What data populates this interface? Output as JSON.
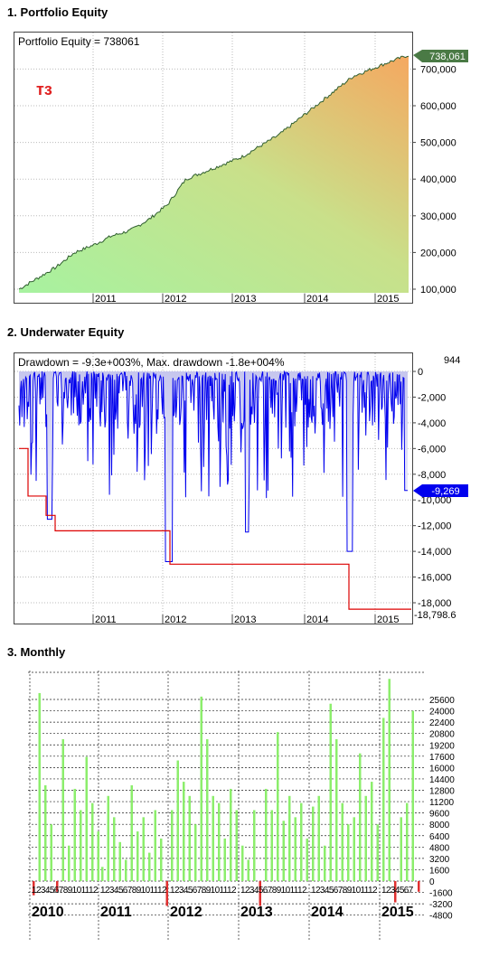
{
  "sections": {
    "s1": "1. Portfolio Equity",
    "s2": "2. Underwater Equity",
    "s3": "3. Monthly"
  },
  "equity": {
    "header": "Portfolio Equity = 738061",
    "badge": "тз",
    "last_value_label": "738,061",
    "y_ticks": [
      "100,000",
      "200,000",
      "300,000",
      "400,000",
      "500,000",
      "600,000",
      "700,000"
    ],
    "x_ticks": [
      "2011",
      "2012",
      "2013",
      "2014",
      "2015"
    ]
  },
  "underwater": {
    "header": "Drawdown = -9.3e+003%, Max. drawdown -1.8e+004%",
    "top_label": "944",
    "last_label": "-9,269",
    "bottom_label": "-18,798.6",
    "y_ticks": [
      "0",
      "-2,000",
      "-4,000",
      "-6,000",
      "-8,000",
      "-10,000",
      "-12,000",
      "-14,000",
      "-16,000",
      "-18,000"
    ],
    "x_ticks": [
      "2011",
      "2012",
      "2013",
      "2014",
      "2015"
    ]
  },
  "monthly": {
    "y_ticks": [
      "25600",
      "24000",
      "22400",
      "20800",
      "19200",
      "17600",
      "16000",
      "14400",
      "12800",
      "11200",
      "9600",
      "8000",
      "6400",
      "4800",
      "3200",
      "1600",
      "0",
      "-1600",
      "-3200",
      "-4800"
    ],
    "year_labels": [
      "2010",
      "2011",
      "2012",
      "2013",
      "2014",
      "2015"
    ],
    "month_strings": [
      "123456789101112",
      "123456789101112",
      "123456789101112",
      "123456789101112",
      "123456789101112",
      "1234567"
    ]
  },
  "chart_data": [
    {
      "type": "area",
      "title": "Portfolio Equity = 738061",
      "x": [
        "2010-04",
        "2010-07",
        "2010-10",
        "2011-01",
        "2011-04",
        "2011-07",
        "2011-10",
        "2012-01",
        "2012-04",
        "2012-07",
        "2012-10",
        "2013-01",
        "2013-04",
        "2013-07",
        "2013-10",
        "2014-01",
        "2014-04",
        "2014-07",
        "2014-10",
        "2015-01",
        "2015-04",
        "2015-07"
      ],
      "series": [
        {
          "values": [
            100000,
            130000,
            160000,
            200000,
            220000,
            245000,
            260000,
            290000,
            330000,
            400000,
            420000,
            440000,
            460000,
            490000,
            520000,
            560000,
            600000,
            640000,
            680000,
            700000,
            720000,
            738061
          ]
        }
      ],
      "ylim": [
        90000,
        760000
      ],
      "grid": true
    },
    {
      "type": "line",
      "title": "Drawdown = -9.3e+003%, Max. drawdown -1.8e+004%",
      "x": [
        "2010-04",
        "2010-09",
        "2011-01",
        "2011-06",
        "2011-12",
        "2012-06",
        "2012-12",
        "2013-06",
        "2013-12",
        "2014-06",
        "2014-09",
        "2015-01",
        "2015-07"
      ],
      "series": [
        {
          "name": "Max. drawdown",
          "values": [
            -6000,
            -11500,
            -12400,
            -12400,
            -15000,
            -15000,
            -15000,
            -15000,
            -15000,
            -15000,
            -18500,
            -18500,
            -18500
          ]
        }
      ],
      "ylim": [
        -18798.6,
        944
      ],
      "grid": true
    },
    {
      "type": "bar",
      "categories": [
        "2010-01",
        "2010-02",
        "2010-03",
        "2010-04",
        "2010-05",
        "2010-06",
        "2010-07",
        "2010-08",
        "2010-09",
        "2010-10",
        "2010-11",
        "2010-12",
        "2011-01",
        "2011-02",
        "2011-03",
        "2011-04",
        "2011-05",
        "2011-06",
        "2011-07",
        "2011-08",
        "2011-09",
        "2011-10",
        "2011-11",
        "2011-12",
        "2012-01",
        "2012-02",
        "2012-03",
        "2012-04",
        "2012-05",
        "2012-06",
        "2012-07",
        "2012-08",
        "2012-09",
        "2012-10",
        "2012-11",
        "2012-12",
        "2013-01",
        "2013-02",
        "2013-03",
        "2013-04",
        "2013-05",
        "2013-06",
        "2013-07",
        "2013-08",
        "2013-09",
        "2013-10",
        "2013-11",
        "2013-12",
        "2014-01",
        "2014-02",
        "2014-03",
        "2014-04",
        "2014-05",
        "2014-06",
        "2014-07",
        "2014-08",
        "2014-09",
        "2014-10",
        "2014-11",
        "2014-12",
        "2015-01",
        "2015-02",
        "2015-03",
        "2015-04",
        "2015-05",
        "2015-06",
        "2015-07"
      ],
      "values": [
        -2000,
        26500,
        13500,
        8000,
        -1500,
        20000,
        5000,
        13000,
        10000,
        17500,
        11000,
        7000,
        2000,
        12000,
        9000,
        5500,
        3000,
        13500,
        7000,
        9000,
        4000,
        10000,
        6000,
        -3500,
        10000,
        17000,
        14000,
        12000,
        8000,
        26000,
        20000,
        12000,
        11000,
        6000,
        13000,
        10000,
        5000,
        3000,
        10000,
        -3500,
        13000,
        10000,
        21000,
        8500,
        12000,
        9000,
        11000,
        6000,
        10500,
        12000,
        5000,
        25000,
        20000,
        11000,
        8000,
        9000,
        18000,
        12000,
        14000,
        8000,
        23000,
        28500,
        -3000,
        9000,
        11000,
        24000,
        -1500
      ],
      "ylim": [
        -4800,
        28000
      ],
      "grid": true
    }
  ]
}
